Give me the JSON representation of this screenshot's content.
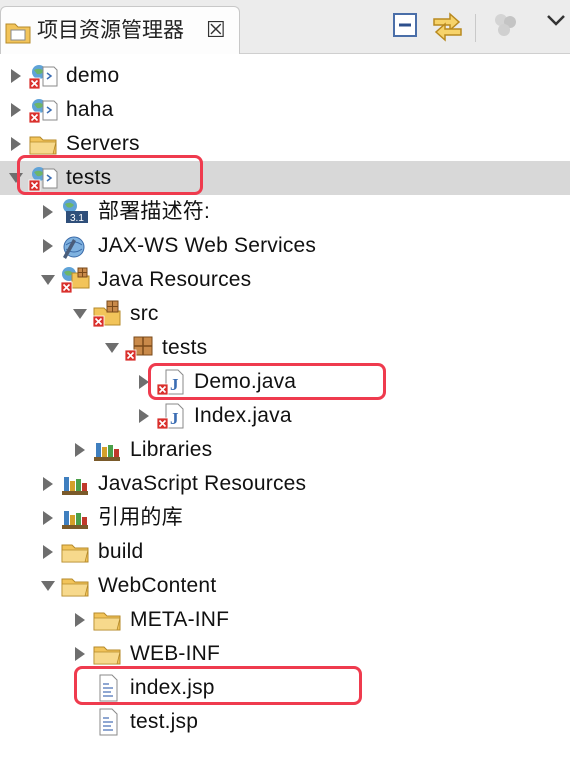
{
  "tab": {
    "title": "项目资源管理器",
    "close": "☒"
  },
  "toolbar": {
    "collapse_icon": "collapse-all-icon",
    "link_icon": "link-with-editor-icon",
    "view_menu_icon": "view-menu-icon",
    "filter_icon": "filter-icon"
  },
  "colors": {
    "highlight": "#ef3b4e",
    "selection": "#d8d8d8",
    "folder": "#f2c45a"
  },
  "tree": [
    {
      "label": "demo"
    },
    {
      "label": "haha"
    },
    {
      "label": "Servers"
    },
    {
      "label": "tests"
    },
    {
      "label": "部署描述符:"
    },
    {
      "label": "JAX-WS Web Services"
    },
    {
      "label": "Java Resources"
    },
    {
      "label": "src"
    },
    {
      "label": "tests"
    },
    {
      "label": "Demo.java"
    },
    {
      "label": "Index.java"
    },
    {
      "label": "Libraries"
    },
    {
      "label": "JavaScript Resources"
    },
    {
      "label": "引用的库"
    },
    {
      "label": "build"
    },
    {
      "label": "WebContent"
    },
    {
      "label": "META-INF"
    },
    {
      "label": "WEB-INF"
    },
    {
      "label": "index.jsp"
    },
    {
      "label": "test.jsp"
    }
  ]
}
